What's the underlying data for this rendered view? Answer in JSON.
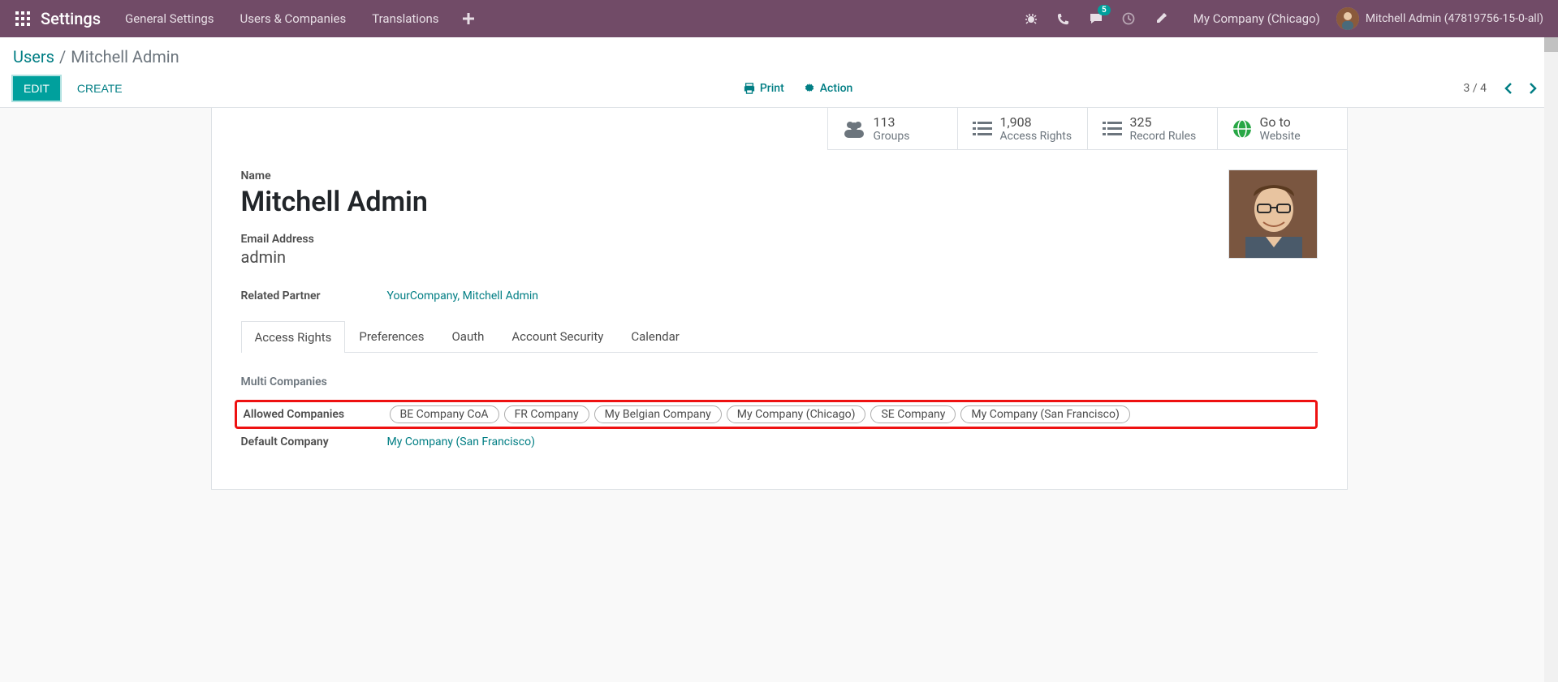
{
  "navbar": {
    "brand": "Settings",
    "menus": [
      "General Settings",
      "Users & Companies",
      "Translations"
    ],
    "message_count": "5",
    "company": "My Company (Chicago)",
    "user": "Mitchell Admin (47819756-15-0-all)"
  },
  "breadcrumb": {
    "parent": "Users",
    "current": "Mitchell Admin"
  },
  "buttons": {
    "edit": "EDIT",
    "create": "CREATE",
    "print": "Print",
    "action": "Action"
  },
  "pager": "3 / 4",
  "stats": {
    "groups": {
      "num": "113",
      "label": "Groups"
    },
    "access": {
      "num": "1,908",
      "label": "Access Rights"
    },
    "rules": {
      "num": "325",
      "label": "Record Rules"
    },
    "goto": {
      "num": "Go to",
      "label": "Website"
    }
  },
  "form": {
    "name_label": "Name",
    "name_value": "Mitchell Admin",
    "email_label": "Email Address",
    "email_value": "admin",
    "partner_label": "Related Partner",
    "partner_value": "YourCompany, Mitchell Admin"
  },
  "tabs": [
    "Access Rights",
    "Preferences",
    "Oauth",
    "Account Security",
    "Calendar"
  ],
  "multi": {
    "section": "Multi Companies",
    "allowed_label": "Allowed Companies",
    "allowed_values": [
      "BE Company CoA",
      "FR Company",
      "My Belgian Company",
      "My Company (Chicago)",
      "SE Company",
      "My Company (San Francisco)"
    ],
    "default_label": "Default Company",
    "default_value": "My Company (San Francisco)"
  }
}
